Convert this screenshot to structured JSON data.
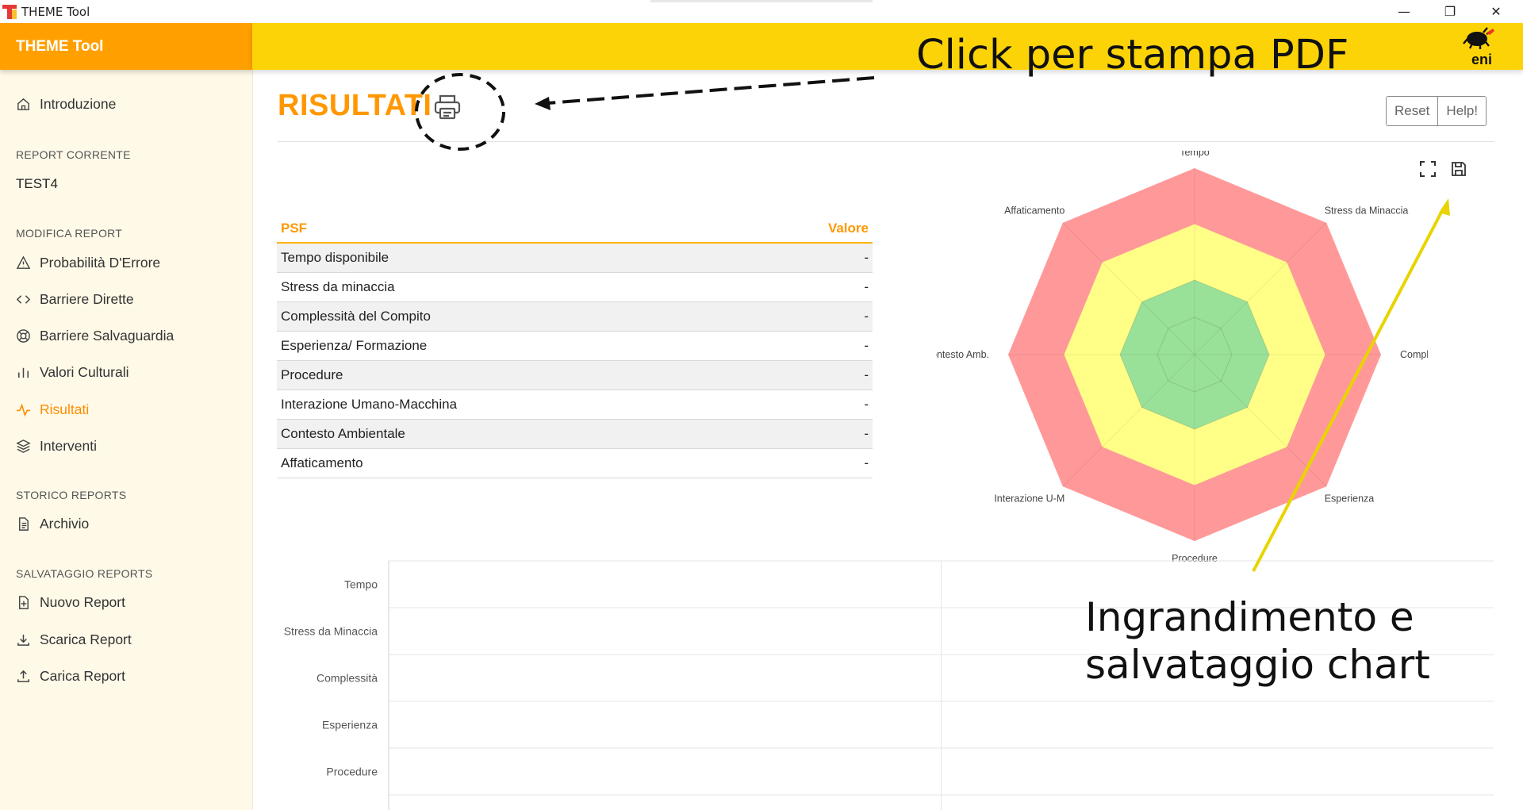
{
  "window": {
    "title": "THEME Tool",
    "controls": {
      "minimize": "—",
      "restore": "❐",
      "close": "✕"
    }
  },
  "sidebar": {
    "brand": "THEME Tool",
    "items": {
      "introduzione": "Introduzione",
      "probabilita": "Probabilità D'Errore",
      "barriere_dirette": "Barriere Dirette",
      "barriere_salvaguardia": "Barriere Salvaguardia",
      "valori_culturali": "Valori Culturali",
      "risultati": "Risultati",
      "interventi": "Interventi",
      "archivio": "Archivio",
      "nuovo_report": "Nuovo Report",
      "scarica_report": "Scarica Report",
      "carica_report": "Carica Report"
    },
    "sections": {
      "report_corrente": "REPORT CORRENTE",
      "modifica_report": "MODIFICA REPORT",
      "storico_reports": "STORICO REPORTS",
      "salvataggio_reports": "SALVATAGGIO REPORTS"
    },
    "current_report": "TEST4",
    "active_item": "Risultati"
  },
  "header": {
    "logo_text": "eni"
  },
  "main": {
    "title": "RISULTATI",
    "buttons": {
      "reset": "Reset",
      "help": "Help!"
    },
    "table": {
      "headers": {
        "psf": "PSF",
        "valore": "Valore"
      },
      "rows": [
        {
          "psf": "Tempo disponibile",
          "valore": "-"
        },
        {
          "psf": "Stress da minaccia",
          "valore": "-"
        },
        {
          "psf": "Complessità del Compito",
          "valore": "-"
        },
        {
          "psf": "Esperienza/ Formazione",
          "valore": "-"
        },
        {
          "psf": "Procedure",
          "valore": "-"
        },
        {
          "psf": "Interazione Umano-Macchina",
          "valore": "-"
        },
        {
          "psf": "Contesto Ambientale",
          "valore": "-"
        },
        {
          "psf": "Affaticamento",
          "valore": "-"
        }
      ]
    }
  },
  "chart_data": [
    {
      "type": "radar",
      "axes": [
        "Tempo",
        "Stress da Minaccia",
        "Complessità",
        "Esperienza",
        "Procedure",
        "Interazione U-M",
        "Contesto Amb.",
        "Affaticamento"
      ],
      "bands": [
        {
          "color": "#ff9999",
          "level": 1.0
        },
        {
          "color": "#ffff88",
          "level": 0.7
        },
        {
          "color": "#99e199",
          "level": 0.4
        }
      ],
      "grid_levels": [
        0.2,
        0.4
      ]
    },
    {
      "type": "bar",
      "orientation": "horizontal",
      "categories": [
        "Tempo",
        "Stress da Minaccia",
        "Complessità",
        "Esperienza",
        "Procedure"
      ],
      "series": []
    }
  ],
  "annotations": {
    "print_pdf": "Click per stampa PDF",
    "chart_zoom_line1": "Ingrandimento e",
    "chart_zoom_line2": "salvataggio chart",
    "arrow_color": "#e8d400"
  },
  "colors": {
    "accent": "#ff9800",
    "brand_orange": "#ffa000",
    "header_yellow": "#fcd307",
    "sidebar_bg": "#fff9e8"
  }
}
